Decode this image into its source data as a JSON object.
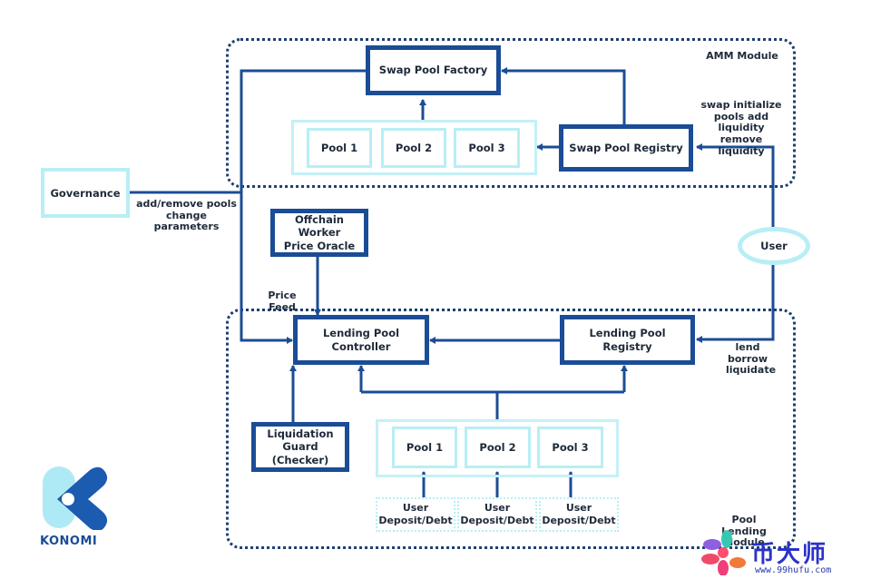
{
  "modules": {
    "amm": {
      "label": "AMM Module"
    },
    "lending": {
      "label": "Pool Lending Module"
    }
  },
  "nodes": {
    "swap_pool_factory": "Swap Pool Factory",
    "swap_pool_registry": "Swap Pool Registry",
    "amm_pools": [
      "Pool 1",
      "Pool 2",
      "Pool 3"
    ],
    "governance": "Governance",
    "offchain_worker": "Offchain Worker Price Oracle",
    "user": "User",
    "lending_pool_controller": "Lending Pool Controller",
    "lending_pool_registry": "Lending Pool Registry",
    "liquidation_guard": "Liquidation Guard (Checker)",
    "lending_pools": [
      "Pool 1",
      "Pool 2",
      "Pool 3"
    ],
    "user_deposits": [
      "User Deposit/Debt",
      "User Deposit/Debt",
      "User Deposit/Debt"
    ]
  },
  "edge_labels": {
    "governance": "add/remove pools change parameters",
    "price_feed": "Price Feed",
    "user_amm": "swap initialize pools add liquidity remove liquidity",
    "user_lending": "lend borrow liquidate"
  },
  "logo": {
    "text": "KONOMI",
    "icon": "konomi-k-logo-icon"
  },
  "watermark": {
    "title": "币大师",
    "url": "www.99hufu.com",
    "icon": "flower-logo-icon"
  },
  "colors": {
    "dark_blue": "#1b4c96",
    "light_cyan": "#b8eef5",
    "dotted": "#1e3f6e"
  }
}
